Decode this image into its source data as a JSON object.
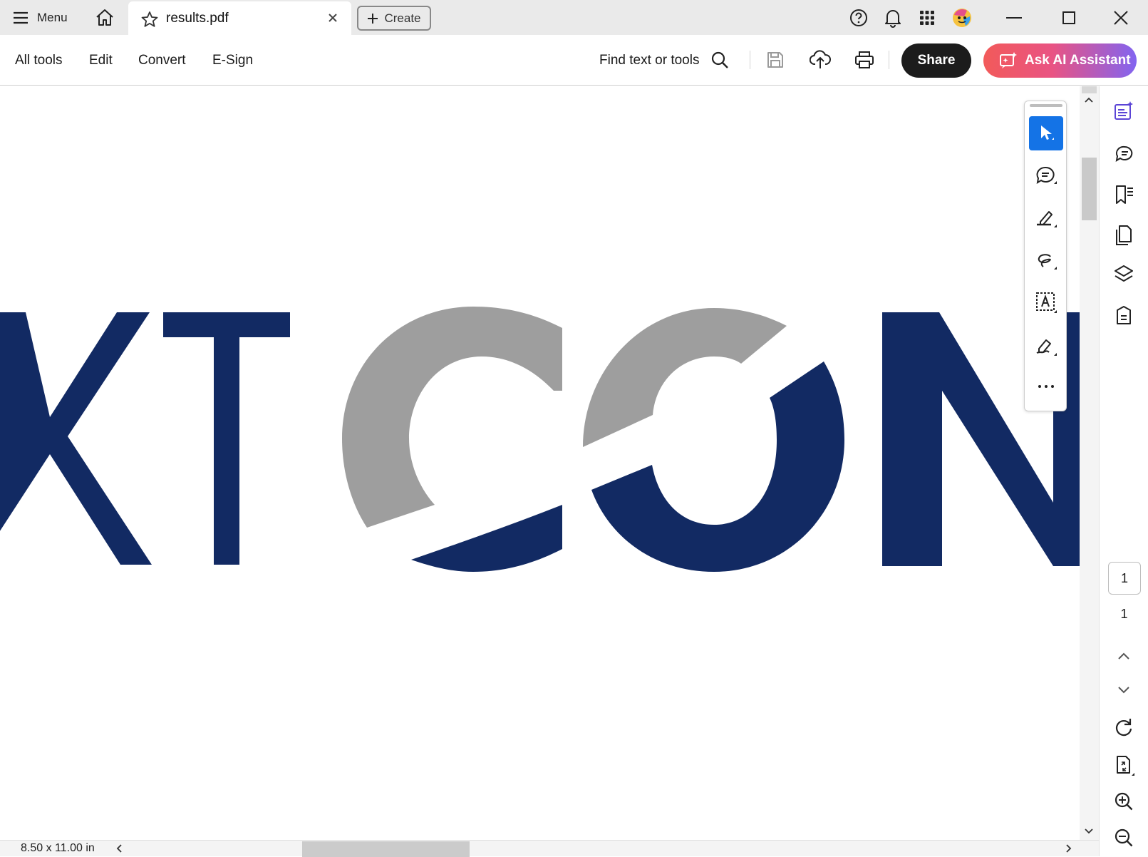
{
  "titlebar": {
    "menu_label": "Menu",
    "tab_title": "results.pdf",
    "create_label": "Create"
  },
  "toolbar": {
    "nav": [
      "All tools",
      "Edit",
      "Convert",
      "E-Sign"
    ],
    "find_label": "Find text or tools",
    "share_label": "Share",
    "ai_label": "Ask AI Assistant"
  },
  "document": {
    "visible_text": "XTCON",
    "colors": {
      "navy": "#122a63",
      "gray": "#9e9e9e"
    }
  },
  "rail": {
    "page_current": "1",
    "page_total": "1"
  },
  "status": {
    "page_size": "8.50 x 11.00 in"
  },
  "colors": {
    "accent_blue": "#1473e6",
    "share_bg": "#1c1c1c"
  }
}
